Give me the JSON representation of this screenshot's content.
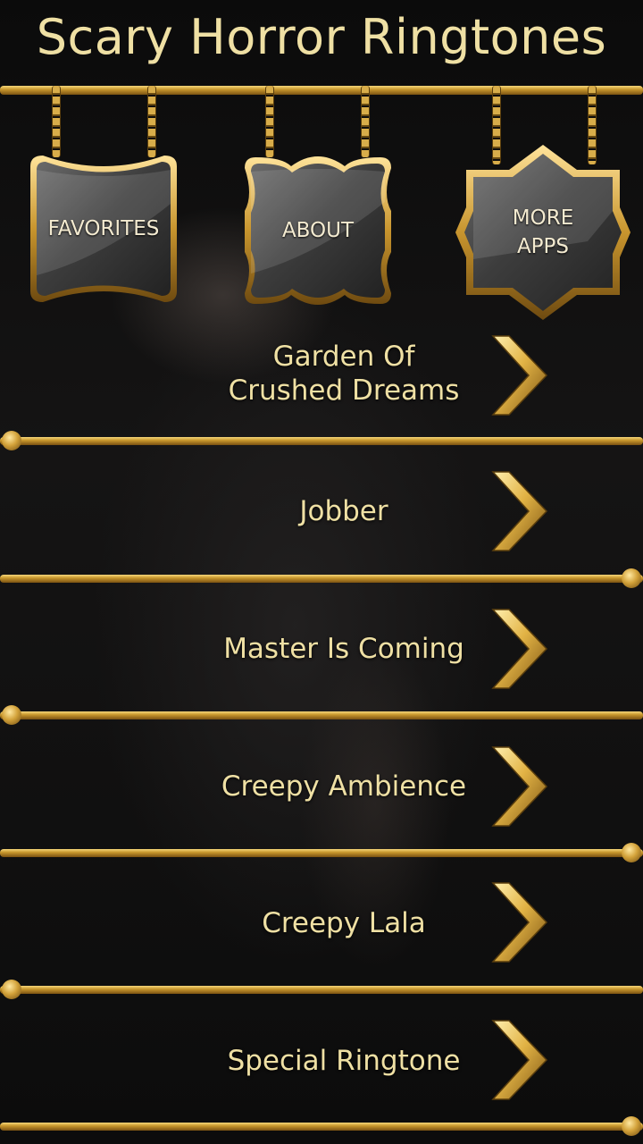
{
  "app": {
    "title": "Scary Horror Ringtones"
  },
  "header_buttons": {
    "favorites": "FAVORITES",
    "about": "ABOUT",
    "more_apps_line1": "MORE",
    "more_apps_line2": "APPS"
  },
  "ringtones": [
    {
      "line1": "Garden Of",
      "line2": "Crushed Dreams"
    },
    {
      "line1": "Jobber",
      "line2": ""
    },
    {
      "line1": "Master Is Coming",
      "line2": ""
    },
    {
      "line1": "Creepy Ambience",
      "line2": ""
    },
    {
      "line1": "Creepy Lala",
      "line2": ""
    },
    {
      "line1": "Special Ringtone",
      "line2": ""
    }
  ],
  "colors": {
    "accent_gold": "#d3a23a",
    "text_gold": "#efe0a4",
    "sign_stone": "#3a3a3a"
  },
  "icons": {
    "row_action": "chevron-right-icon"
  }
}
